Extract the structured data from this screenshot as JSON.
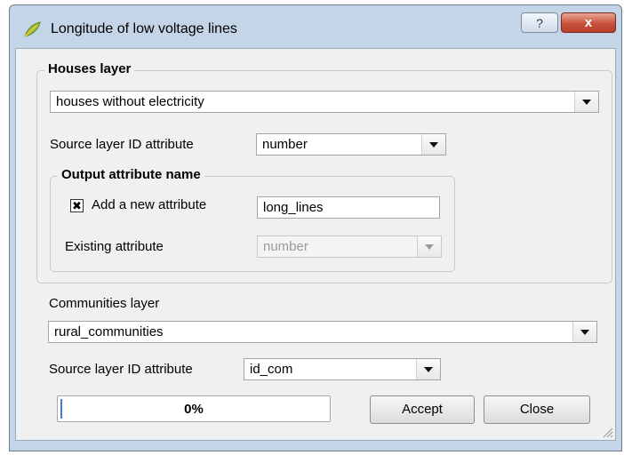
{
  "window": {
    "title": "Longitude of low voltage lines",
    "help_glyph": "?",
    "close_glyph": "x"
  },
  "houses_group": {
    "title": "Houses layer",
    "layer_value": "houses without electricity",
    "source_id_label": "Source layer ID attribute",
    "source_id_value": "number",
    "output_group": {
      "title": "Output attribute name",
      "add_checked": true,
      "add_label": "Add a new attribute",
      "add_value": "long_lines",
      "existing_label": "Existing attribute",
      "existing_value": "number"
    }
  },
  "communities": {
    "label": "Communities layer",
    "layer_value": "rural_communities",
    "source_id_label": "Source layer ID attribute",
    "source_id_value": "id_com"
  },
  "progress": {
    "value": 0.0,
    "text": "0%"
  },
  "buttons": {
    "accept": "Accept",
    "close": "Close"
  },
  "colors": {
    "accent": "#4a78c8",
    "close_red": "#c8503a"
  },
  "icons": {
    "app": "qgis-leaf-icon",
    "checkbox_mark": "x-mark"
  }
}
